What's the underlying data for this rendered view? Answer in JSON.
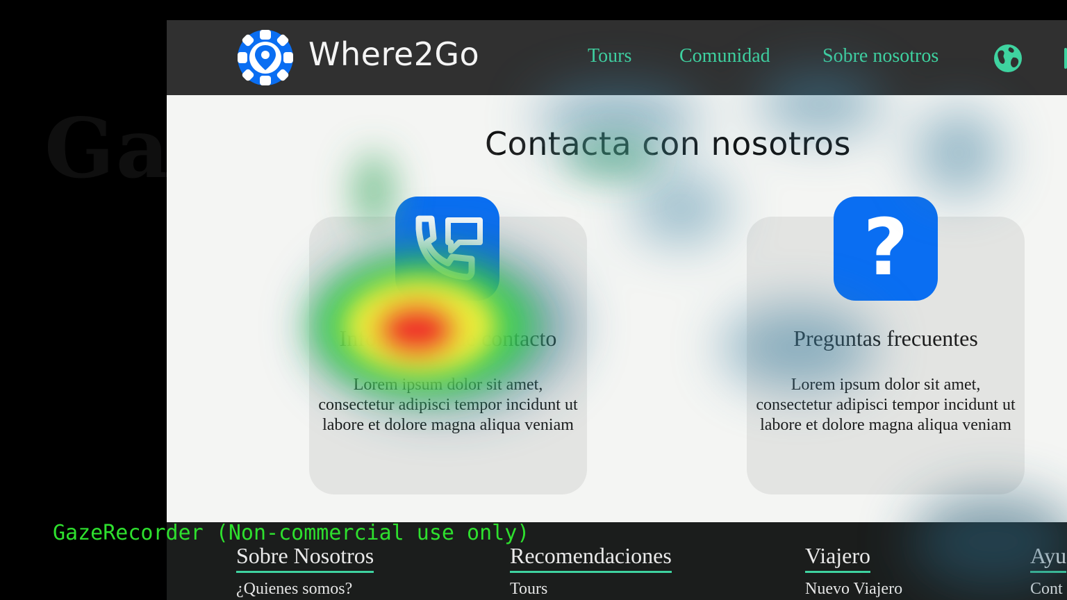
{
  "brand": {
    "name": "Where2Go",
    "logo_icon": "location-pin-gear-icon",
    "accent_color": "#3fd3a0",
    "primary_blue": "#0a6ef2"
  },
  "nav": {
    "items": [
      {
        "label": "Tours"
      },
      {
        "label": "Comunidad"
      },
      {
        "label": "Sobre nosotros"
      }
    ],
    "language_icon": "globe-icon"
  },
  "main": {
    "title": "Contacta con nosotros",
    "cards": [
      {
        "icon": "phone-message-icon",
        "title": "Información de contacto",
        "text": "Lorem ipsum dolor sit amet, consectetur adipisci tempor incidunt ut labore et dolore magna aliqua veniam"
      },
      {
        "icon": "question-mark-icon",
        "title": "Preguntas frecuentes",
        "text": "Lorem ipsum dolor sit amet, consectetur adipisci tempor incidunt ut labore et dolore magna aliqua veniam"
      }
    ]
  },
  "footer": {
    "columns": [
      {
        "heading": "Sobre Nosotros",
        "link": "¿Quienes somos?"
      },
      {
        "heading": "Recomendaciones",
        "link": "Tours"
      },
      {
        "heading": "Viajero",
        "link": "Nuevo Viajero"
      },
      {
        "heading": "Ayu",
        "link": "Cont"
      }
    ]
  },
  "overlay": {
    "watermark": "GazeRecorder",
    "label": "GazeRecorder (Non-commercial use only)"
  }
}
